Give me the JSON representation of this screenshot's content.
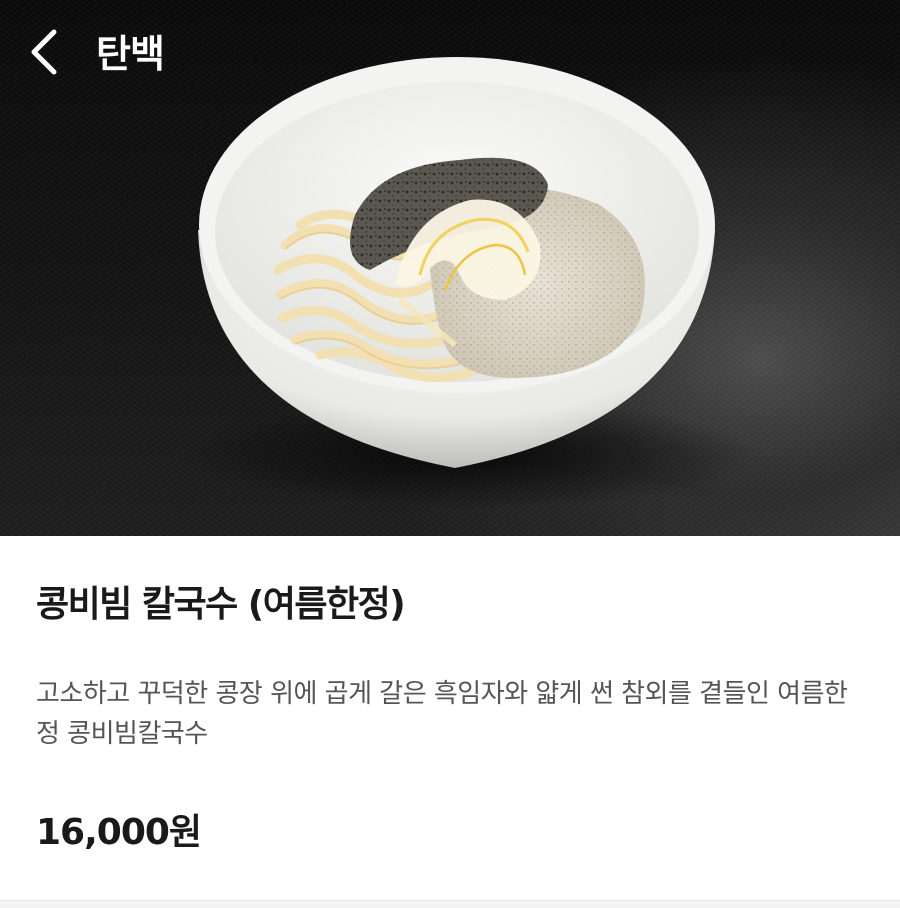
{
  "header": {
    "title": "탄백",
    "back_icon": "chevron-left-icon"
  },
  "hero": {
    "subject": "noodle-bowl-photo"
  },
  "menu": {
    "name": "콩비빔 칼국수 (여름한정)",
    "description": "고소하고 꾸덕한 콩장 위에 곱게 갈은 흑임자와 얇게 썬 참외를 곁들인 여름한정 콩비빔칼국수",
    "price": "16,000원"
  },
  "colors": {
    "text_primary": "#1a1a1a",
    "text_secondary": "#555555",
    "header_text": "#ffffff"
  }
}
